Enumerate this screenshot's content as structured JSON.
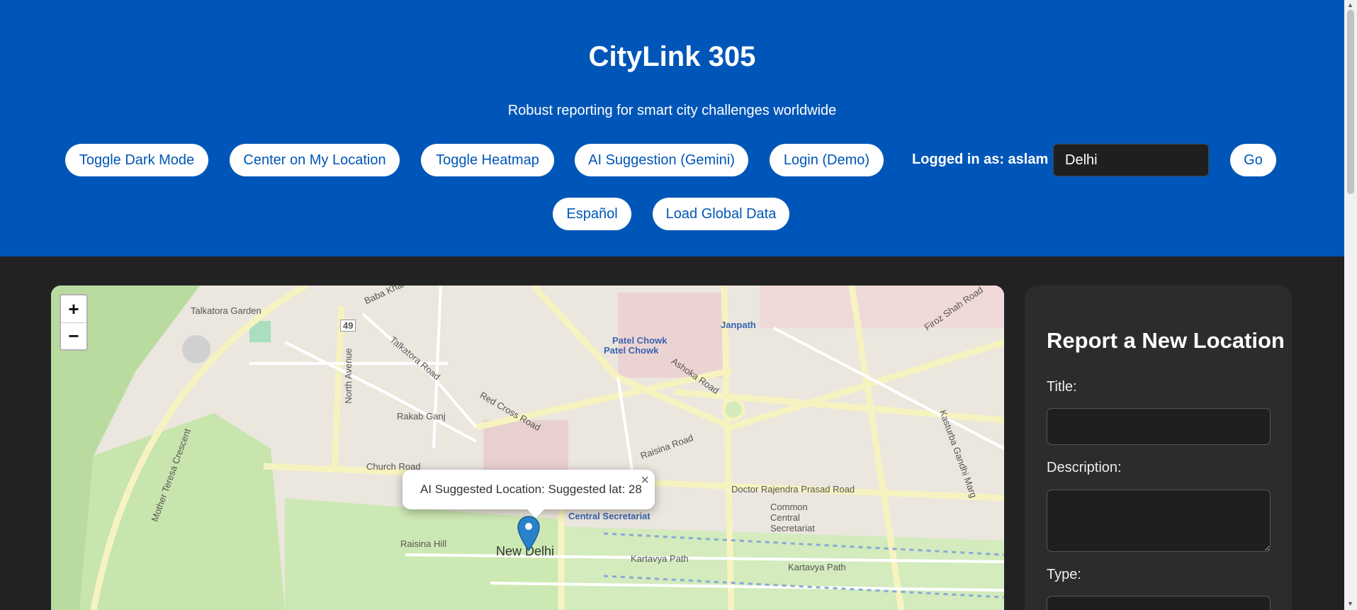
{
  "header": {
    "title": "CityLink 305",
    "subtitle": "Robust reporting for smart city challenges worldwide",
    "buttons": {
      "dark_mode": "Toggle Dark Mode",
      "center": "Center on My Location",
      "heatmap": "Toggle Heatmap",
      "ai": "AI Suggestion (Gemini)",
      "login": "Login (Demo)",
      "go": "Go",
      "spanish": "Español",
      "global": "Load Global Data"
    },
    "logged_in": "Logged in as: aslam",
    "city_value": "Delhi"
  },
  "map": {
    "zoom_in": "+",
    "zoom_out": "−",
    "popup_text": "AI Suggested Location: Suggested lat: 28",
    "popup_close": "×",
    "labels": {
      "talkatora": "Talkatora Garden",
      "rakab": "Rakab Ganj",
      "patel1": "Patel Chowk",
      "patel2": "Patel Chowk",
      "janpath": "Janpath",
      "central": "Central Secretariat",
      "newdelhi": "New Delhi",
      "raisina_hill": "Raisina Hill",
      "church": "Church Road",
      "kartavya1": "Kartavya Path",
      "kartavya2": "Kartavya Path",
      "rajendra": "Doctor Rajendra Prasad Road",
      "common": "Common Central Secretariat",
      "ashoka": "Ashoka Road",
      "raisina_road": "Raisina Road",
      "red_cross": "Red Cross Road",
      "north_ave": "North Avenue",
      "mother": "Mother Teresa Crescent",
      "talkatora_rd": "Talkatora Road",
      "firoz": "Firoz Shah Road",
      "kasturba": "Kasturba Gandhi Marg",
      "baba": "Baba Khar",
      "route49": "49"
    }
  },
  "panel": {
    "title": "Report a New Location",
    "title_label": "Title:",
    "description_label": "Description:",
    "type_label": "Type:"
  }
}
